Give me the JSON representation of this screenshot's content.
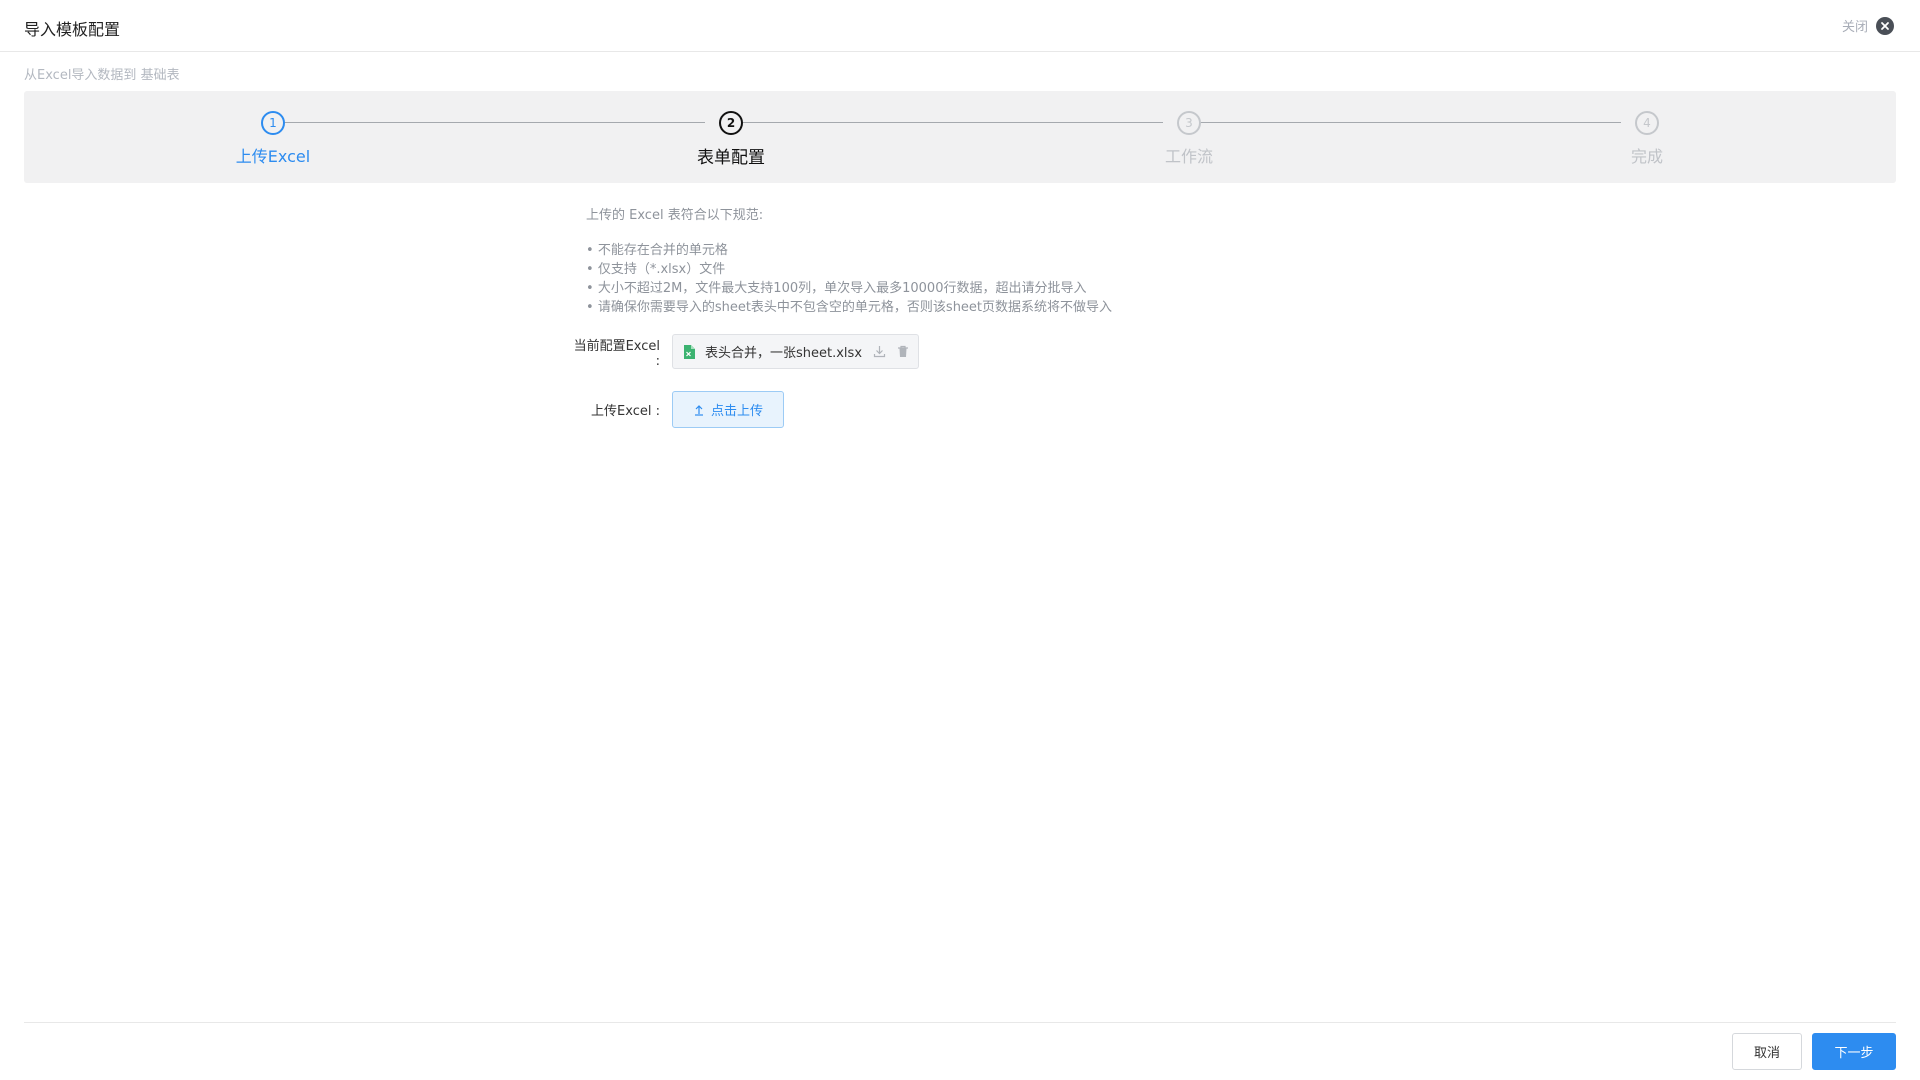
{
  "header": {
    "title": "导入模板配置",
    "close_label": "关闭",
    "close_icon": "close-icon"
  },
  "subtitle": "从Excel导入数据到 基础表",
  "steps": [
    {
      "number": "1",
      "label": "上传Excel",
      "state": "done"
    },
    {
      "number": "2",
      "label": "表单配置",
      "state": "active"
    },
    {
      "number": "3",
      "label": "工作流",
      "state": "pending"
    },
    {
      "number": "4",
      "label": "完成",
      "state": "pending"
    }
  ],
  "rules": {
    "title": "上传的 Excel 表符合以下规范:",
    "items": [
      "不能存在合并的单元格",
      "仅支持（*.xlsx）文件",
      "大小不超过2M，文件最大支持100列，单次导入最多10000行数据，超出请分批导入",
      "请确保你需要导入的sheet表头中不包含空的单元格，否则该sheet页数据系统将不做导入"
    ]
  },
  "current_excel": {
    "label": "当前配置Excel :",
    "file_name": "表头合并，一张sheet.xlsx",
    "file_icon": "excel-file-icon",
    "file_icon_color": "#3cb371",
    "actions": [
      "download-icon",
      "trash-icon"
    ]
  },
  "upload": {
    "label": "上传Excel :",
    "button_label": "点击上传",
    "button_icon": "upload-icon"
  },
  "footer": {
    "cancel_label": "取消",
    "next_label": "下一步"
  },
  "colors": {
    "primary": "#2d8cf0",
    "step_bar_bg": "#f1f1f2",
    "muted_text": "#8e939b"
  }
}
